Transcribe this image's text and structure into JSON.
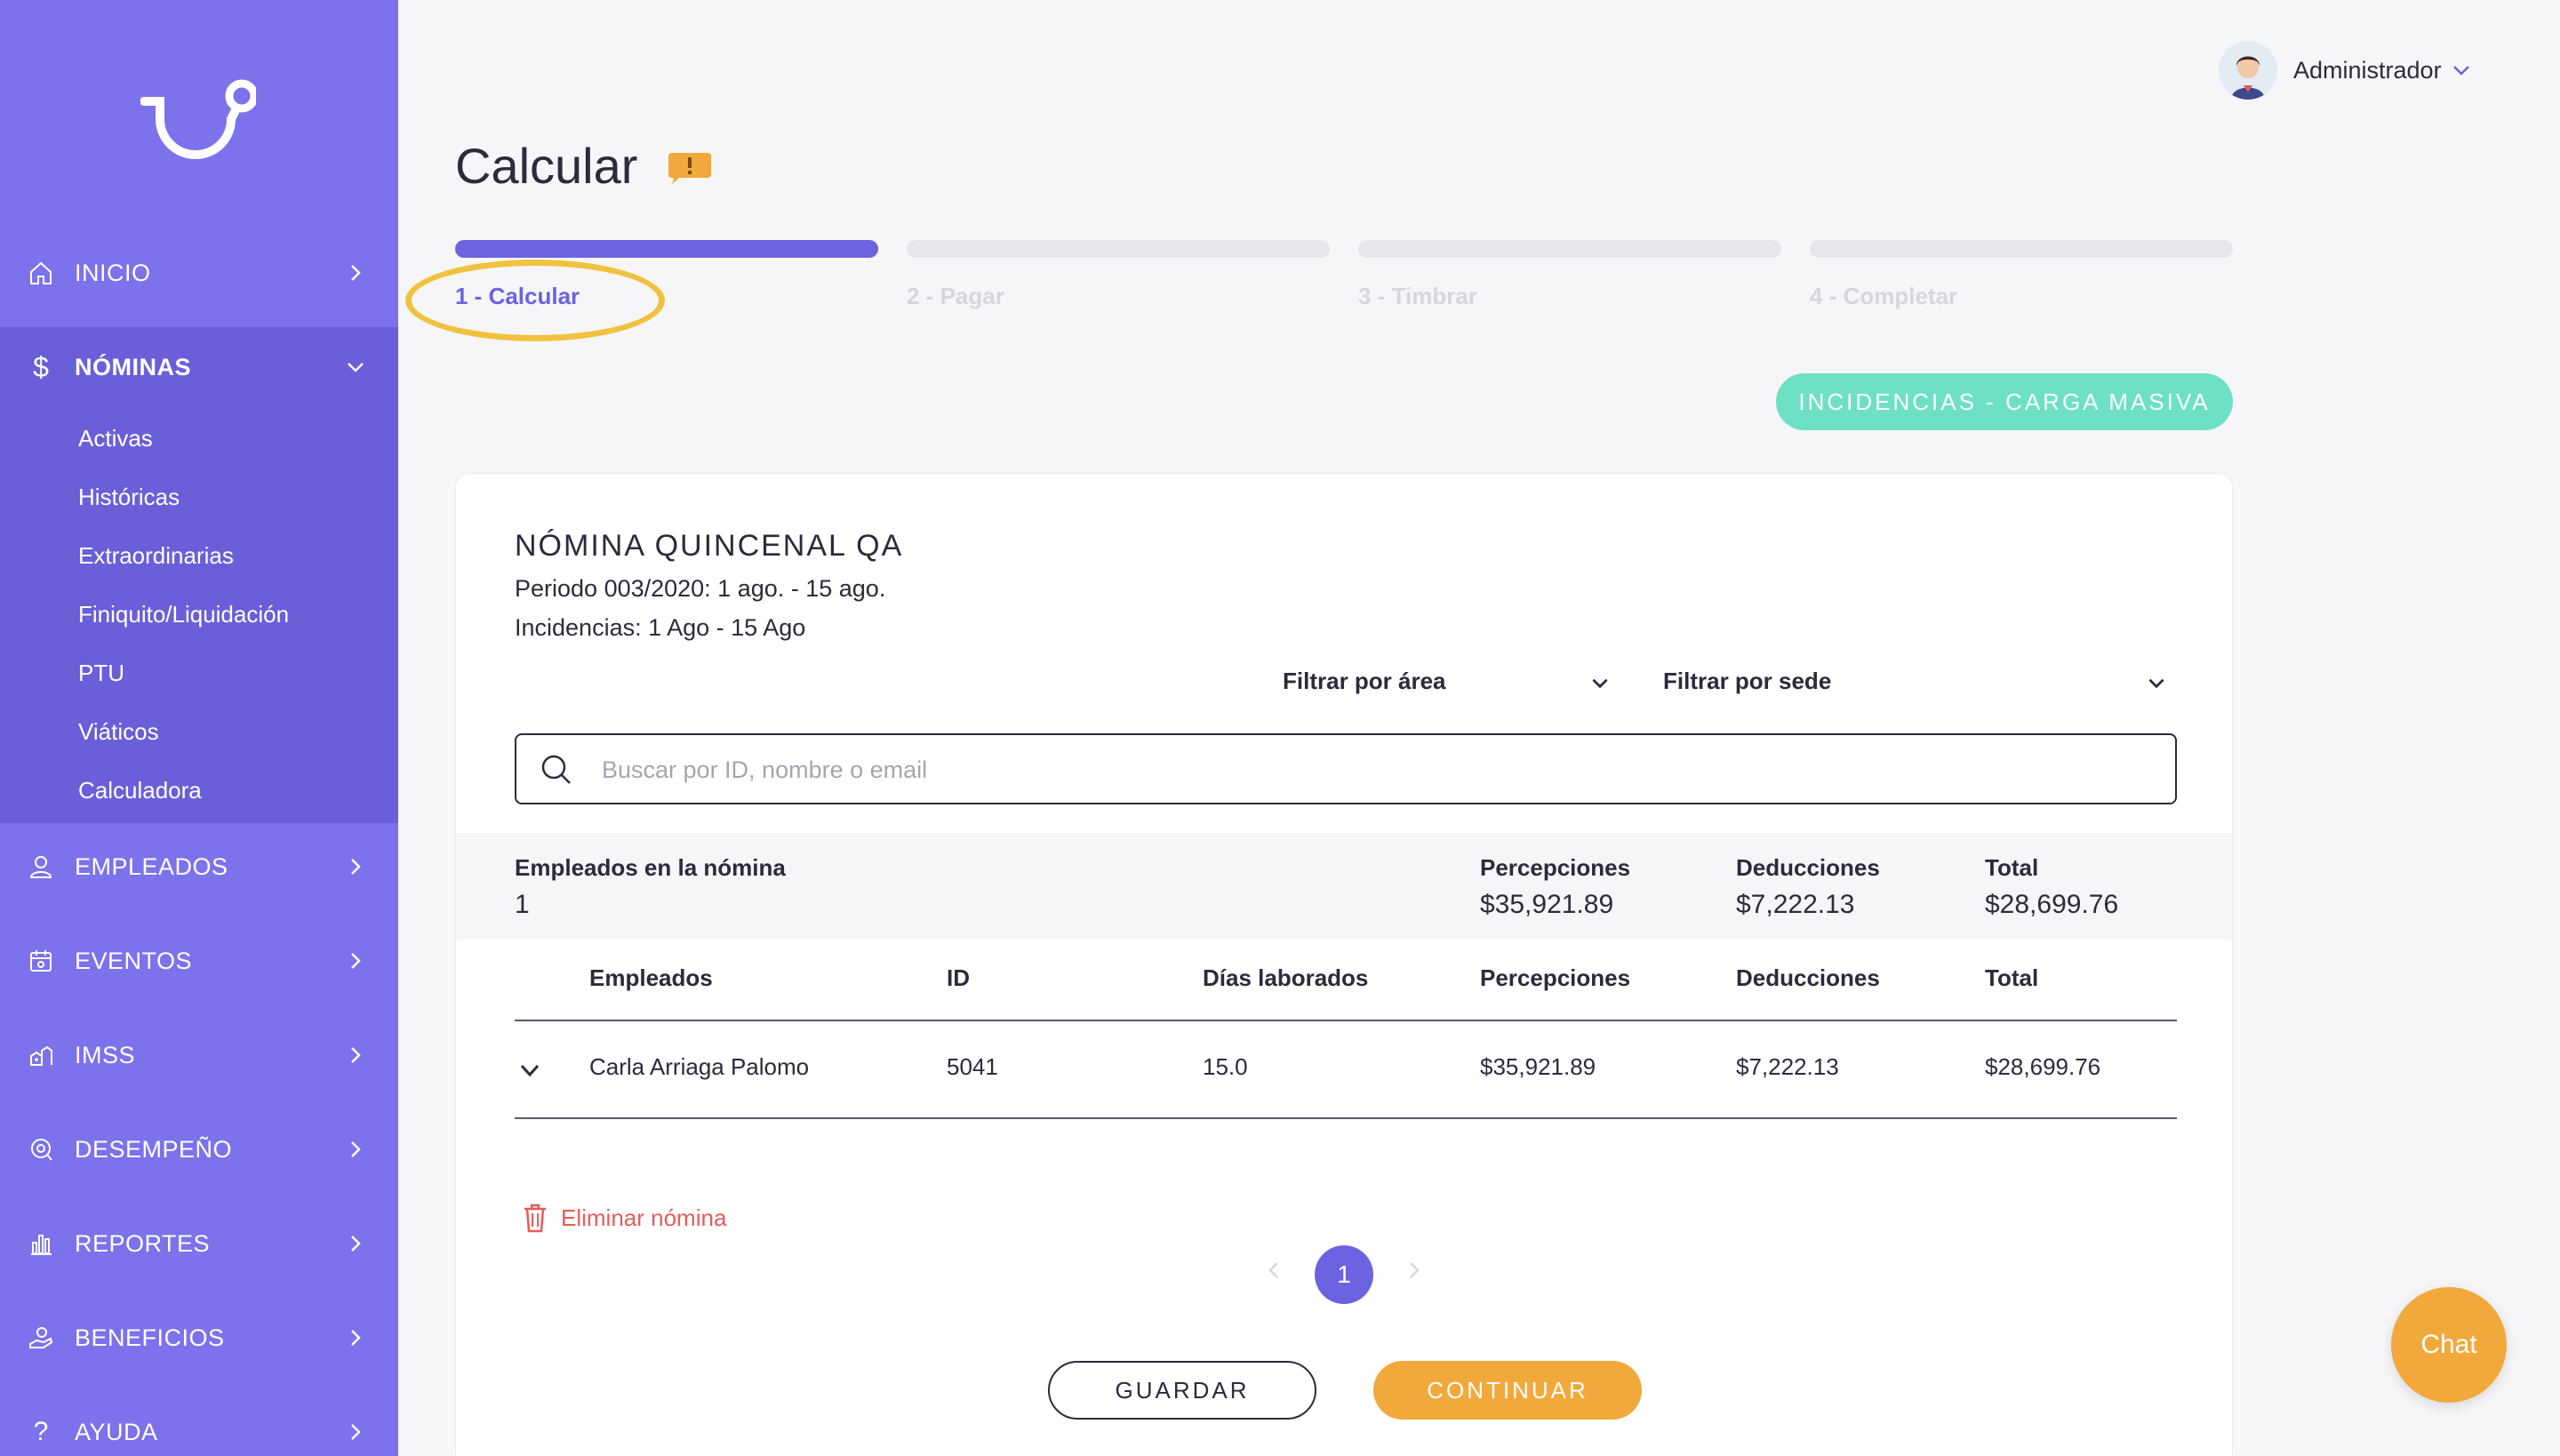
{
  "sidebar": {
    "nav": {
      "inicio": "INICIO",
      "nominas": "NÓMINAS",
      "empleados": "EMPLEADOS",
      "eventos": "EVENTOS",
      "imss": "IMSS",
      "desempeno": "DESEMPEÑO",
      "reportes": "REPORTES",
      "beneficios": "BENEFICIOS",
      "ayuda": "AYUDA"
    },
    "submenu": [
      "Activas",
      "Históricas",
      "Extraordinarias",
      "Finiquito/Liquidación",
      "PTU",
      "Viáticos",
      "Calculadora"
    ]
  },
  "user": {
    "name": "Administrador"
  },
  "page": {
    "title": "Calcular"
  },
  "steps": [
    "1 - Calcular",
    "2 - Pagar",
    "3 - Timbrar",
    "4 - Completar"
  ],
  "actions": {
    "mass_upload": "INCIDENCIAS - CARGA MASIVA"
  },
  "payroll": {
    "title": "NÓMINA QUINCENAL QA",
    "period": "Periodo 003/2020: 1 ago. - 15 ago.",
    "incidents": "Incidencias: 1 Ago - 15 Ago"
  },
  "filters": {
    "area": "Filtrar por área",
    "sede": "Filtrar por sede"
  },
  "search": {
    "placeholder": "Buscar por ID, nombre o email",
    "value": ""
  },
  "summary": {
    "employees_label": "Empleados en la nómina",
    "employees_value": "1",
    "perceptions_label": "Percepciones",
    "perceptions_value": "$35,921.89",
    "deductions_label": "Deducciones",
    "deductions_value": "$7,222.13",
    "total_label": "Total",
    "total_value": "$28,699.76"
  },
  "table": {
    "headers": [
      "Empleados",
      "ID",
      "Días laborados",
      "Percepciones",
      "Deducciones",
      "Total"
    ],
    "rows": [
      [
        "Carla Arriaga Palomo",
        "5041",
        "15.0",
        "$35,921.89",
        "$7,222.13",
        "$28,699.76"
      ]
    ]
  },
  "delete_label": "Eliminar nómina",
  "pagination": {
    "current": "1"
  },
  "buttons": {
    "save": "GUARDAR",
    "continue": "CONTINUAR"
  },
  "chat": {
    "label": "Chat"
  },
  "colors": {
    "sidebar": "#7c72eb",
    "sidebar_active": "#6a5fd8",
    "accent": "#6c63e0",
    "teal": "#6ee0c6",
    "orange": "#f2a93b",
    "danger": "#e85a5a",
    "highlight": "#f0c23e"
  }
}
